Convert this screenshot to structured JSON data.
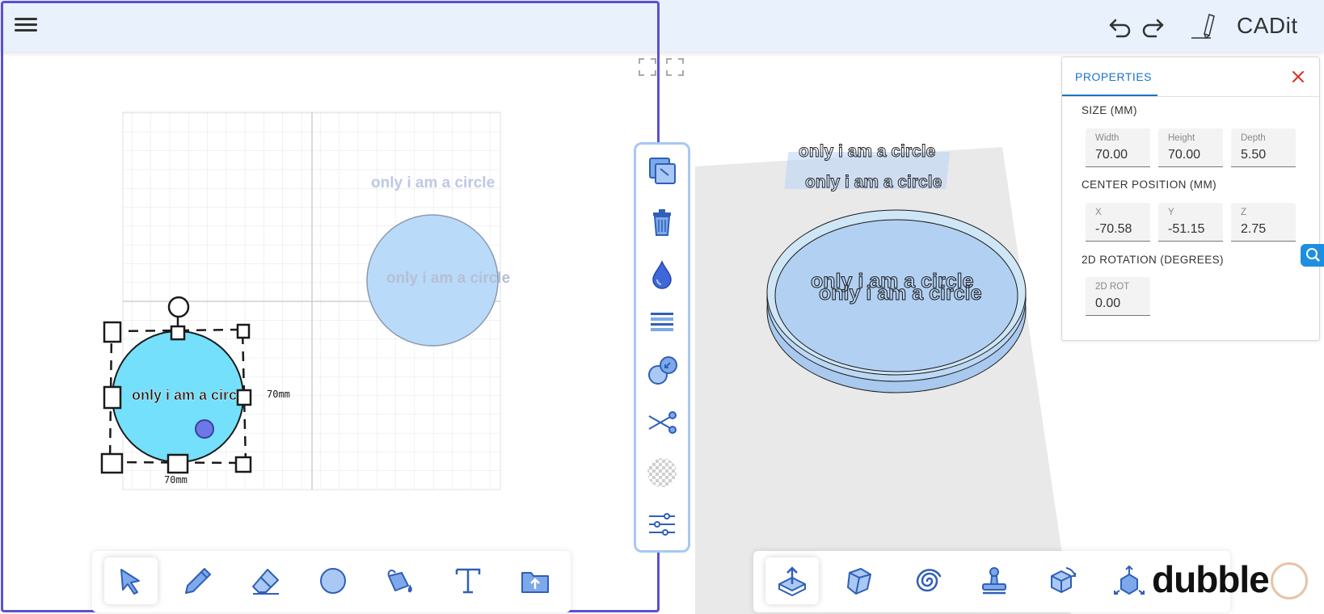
{
  "app": {
    "brand": "CADit"
  },
  "canvas2d": {
    "label_selected": "only i am a circle",
    "label_ghost": "only i am a circle",
    "label_ghost_top": "only i am a circle",
    "dim_width": "70mm",
    "dim_height": "70mm"
  },
  "viewport3d": {
    "label_text": "only i am a circle",
    "label_text_floating": "only i am a circle"
  },
  "properties": {
    "tab_label": "PROPERTIES",
    "size_label": "SIZE (MM)",
    "width_label": "Width",
    "width_value": "70.00",
    "height_label": "Height",
    "height_value": "70.00",
    "depth_label": "Depth",
    "depth_value": "5.50",
    "center_label": "CENTER POSITION (MM)",
    "x_label": "X",
    "x_value": "-70.58",
    "y_label": "Y",
    "y_value": "-51.15",
    "z_label": "Z",
    "z_value": "2.75",
    "rotation_label": "2D ROTATION (DEGREES)",
    "rot_label": "2D ROT",
    "rot_value": "0.00"
  },
  "watermark": {
    "text": "dubble"
  },
  "colors": {
    "accent": "#1a73c8",
    "frame": "#5b50d6",
    "shape_fill": "#74e0fb",
    "ghost_fill": "#b9daf8",
    "close": "#d93025"
  }
}
